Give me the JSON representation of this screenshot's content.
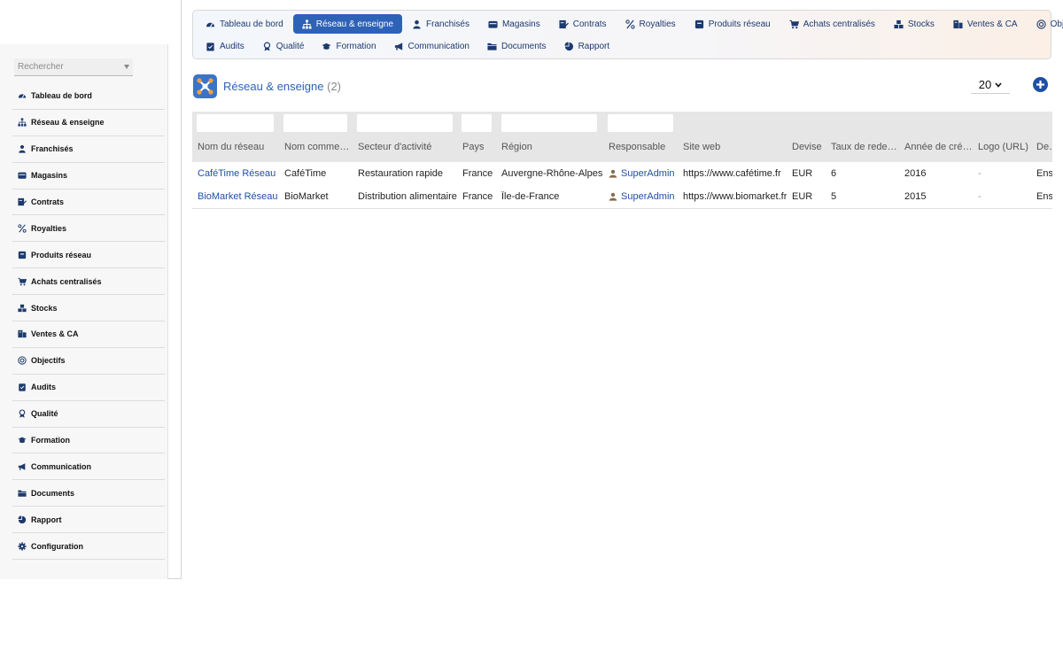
{
  "sidebar": {
    "search_placeholder": "Rechercher",
    "items": [
      {
        "label": "Tableau de bord",
        "icon": "dashboard-icon"
      },
      {
        "label": "Réseau & enseigne",
        "icon": "network-icon"
      },
      {
        "label": "Franchisés",
        "icon": "user-icon"
      },
      {
        "label": "Magasins",
        "icon": "store-icon"
      },
      {
        "label": "Contrats",
        "icon": "contract-icon"
      },
      {
        "label": "Royalties",
        "icon": "percent-icon"
      },
      {
        "label": "Produits réseau",
        "icon": "box-icon"
      },
      {
        "label": "Achats centralisés",
        "icon": "cart-icon"
      },
      {
        "label": "Stocks",
        "icon": "stock-icon"
      },
      {
        "label": "Ventes & CA",
        "icon": "sales-icon"
      },
      {
        "label": "Objectifs",
        "icon": "target-icon"
      },
      {
        "label": "Audits",
        "icon": "clipboard-icon"
      },
      {
        "label": "Qualité",
        "icon": "award-icon"
      },
      {
        "label": "Formation",
        "icon": "graduation-icon"
      },
      {
        "label": "Communication",
        "icon": "megaphone-icon"
      },
      {
        "label": "Documents",
        "icon": "folder-icon"
      },
      {
        "label": "Rapport",
        "icon": "pie-chart-icon"
      },
      {
        "label": "Configuration",
        "icon": "gear-icon"
      }
    ]
  },
  "topnav": {
    "row1": [
      {
        "label": "Tableau de bord",
        "icon": "dashboard-icon",
        "active": false
      },
      {
        "label": "Réseau & enseigne",
        "icon": "network-icon",
        "active": true
      },
      {
        "label": "Franchisés",
        "icon": "user-icon",
        "active": false
      },
      {
        "label": "Magasins",
        "icon": "store-icon",
        "active": false
      },
      {
        "label": "Contrats",
        "icon": "contract-icon",
        "active": false
      },
      {
        "label": "Royalties",
        "icon": "percent-icon",
        "active": false
      },
      {
        "label": "Produits réseau",
        "icon": "box-icon",
        "active": false
      },
      {
        "label": "Achats centralisés",
        "icon": "cart-icon",
        "active": false
      },
      {
        "label": "Stocks",
        "icon": "stock-icon",
        "active": false
      },
      {
        "label": "Ventes & CA",
        "icon": "sales-icon",
        "active": false
      },
      {
        "label": "Objectifs",
        "icon": "target-icon",
        "active": false
      }
    ],
    "row2": [
      {
        "label": "Audits",
        "icon": "clipboard-icon",
        "active": false
      },
      {
        "label": "Qualité",
        "icon": "award-icon",
        "active": false
      },
      {
        "label": "Formation",
        "icon": "graduation-icon",
        "active": false
      },
      {
        "label": "Communication",
        "icon": "megaphone-icon",
        "active": false
      },
      {
        "label": "Documents",
        "icon": "folder-icon",
        "active": false
      },
      {
        "label": "Rapport",
        "icon": "pie-chart-icon",
        "active": false
      }
    ]
  },
  "page": {
    "title": "Réseau & enseigne",
    "count": "(2)",
    "per_page": "20"
  },
  "table": {
    "columns": [
      "Nom du réseau",
      "Nom commercial",
      "Secteur d'activité",
      "Pays",
      "Région",
      "Responsable",
      "Site web",
      "Devise",
      "Taux de redevance",
      "Année de création",
      "Logo (URL)",
      "Description"
    ],
    "rows": [
      [
        "CaféTime Réseau",
        "CaféTime",
        "Restauration rapide",
        "France",
        "Auvergne-Rhône-Alpes",
        "SuperAdmin",
        "https://www.cafétime.fr",
        "EUR",
        "6",
        "2016",
        "-",
        "Ens"
      ],
      [
        "BioMarket Réseau",
        "BioMarket",
        "Distribution alimentaire",
        "France",
        "Île-de-France",
        "SuperAdmin",
        "https://www.biomarket.fr",
        "EUR",
        "5",
        "2015",
        "-",
        "Ens"
      ]
    ]
  },
  "colors": {
    "accent": "#2e62b6",
    "link": "#1f4fa6",
    "header_bg": "#e6e6e6"
  }
}
